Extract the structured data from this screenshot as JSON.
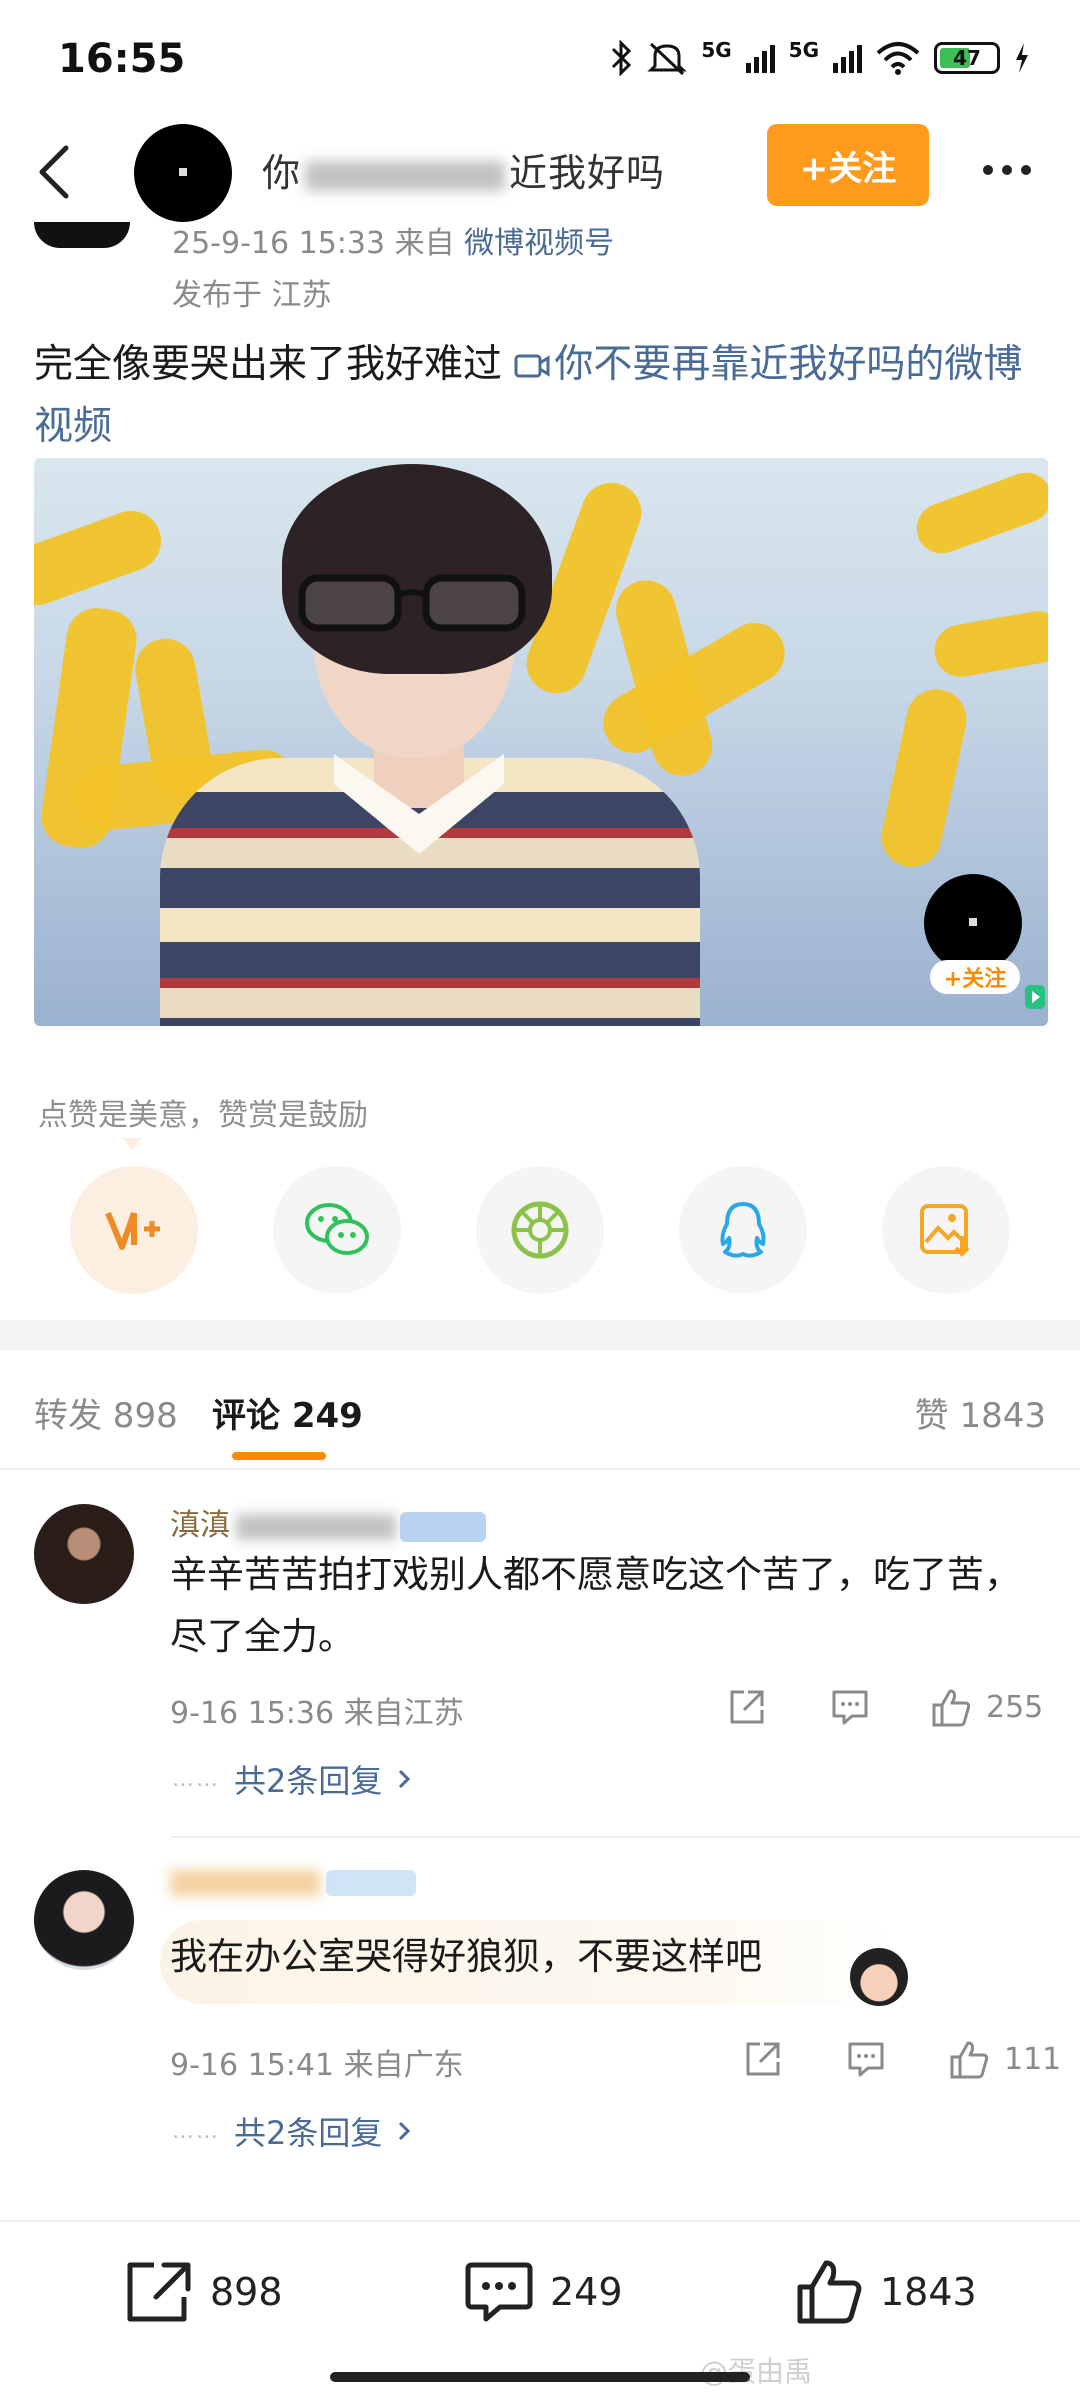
{
  "status_bar": {
    "time": "16:55",
    "net_1": "5G",
    "net_2": "5G",
    "battery": "47"
  },
  "header": {
    "title_visible_start": "你",
    "title_visible_end": "近我好吗",
    "follow_label": "+关注"
  },
  "post": {
    "time_source_prefix": "25-9-16 15:33  来自 ",
    "source": "微博视频号",
    "location": "发布于 江苏",
    "text": "完全像要哭出来了我好难过 ",
    "link_icon": "video-icon",
    "link_text": "你不要再靠近我好吗的微博视频",
    "video_follow_label": "+关注"
  },
  "reward": {
    "tip": "点赞是美意，赞赏是鼓励",
    "buttons": [
      "reward-icon",
      "wechat-icon",
      "moments-icon",
      "qq-icon",
      "save-image-icon"
    ]
  },
  "tabs": {
    "repost": "转发 898",
    "comments": "评论 249",
    "likes": "赞 1843"
  },
  "comments": [
    {
      "name_visible": "滇滇",
      "text": "辛辛苦苦拍打戏别人都不愿意吃这个苦了，吃了苦，尽了全力。",
      "meta": "9-16 15:36  来自江苏",
      "likes": "255",
      "replies": "共2条回复"
    },
    {
      "name_visible": "",
      "text": "我在办公室哭得好狼狈，不要这样吧",
      "meta": "9-16 15:41  来自广东",
      "likes": "111",
      "replies": "共2条回复"
    }
  ],
  "bottom_bar": {
    "reposts": "898",
    "comments": "249",
    "likes": "1843"
  },
  "watermark": "@蛋由禹",
  "colors": {
    "accent": "#ff9a1b",
    "link": "#4a6b96",
    "muted": "#8a8a8a"
  }
}
